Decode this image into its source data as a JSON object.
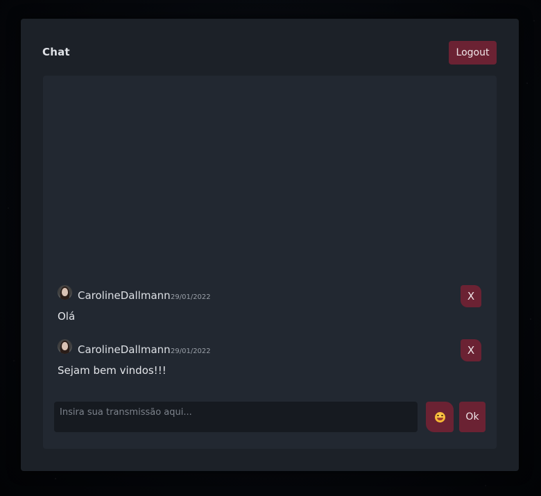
{
  "header": {
    "title": "Chat",
    "logout_label": "Logout"
  },
  "messages": [
    {
      "username": "CarolineDallmann",
      "date": "29/01/2022",
      "text": "Olá",
      "delete_label": "X",
      "avatar_icon": "user-avatar-photo"
    },
    {
      "username": "CarolineDallmann",
      "date": "29/01/2022",
      "text": "Sejam bem vindos!!!",
      "delete_label": "X",
      "avatar_icon": "user-avatar-photo"
    }
  ],
  "composer": {
    "placeholder": "Insira sua transmissão aqui...",
    "value": "",
    "emoji_icon": "smiley-emoji-icon",
    "send_label": "Ok"
  },
  "colors": {
    "accent": "#6b2233",
    "panel": "#1c2128",
    "body": "#222831",
    "input": "#161a20"
  }
}
